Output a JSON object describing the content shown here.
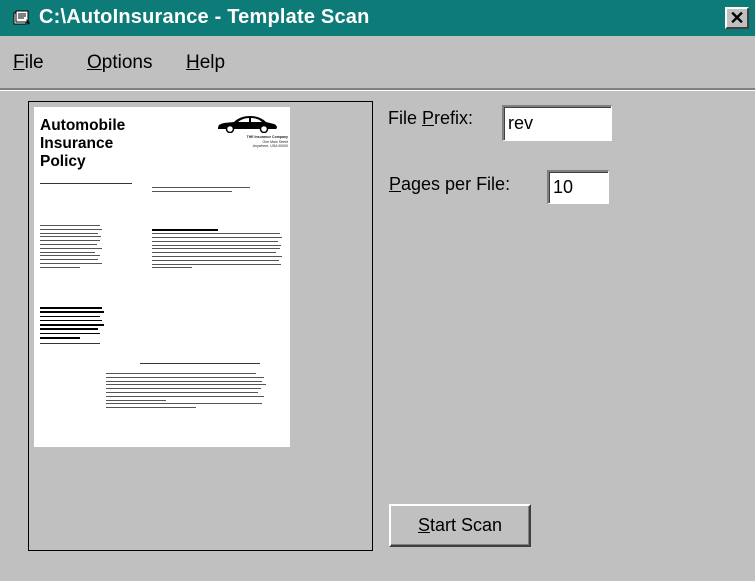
{
  "window": {
    "title": "C:\\AutoInsurance - Template Scan",
    "close_label": "✕"
  },
  "menu": [
    {
      "first": "F",
      "rest": "ile"
    },
    {
      "first": "O",
      "rest": "ptions"
    },
    {
      "first": "H",
      "rest": "elp"
    }
  ],
  "preview": {
    "title": [
      "Automobile",
      "Insurance",
      "Policy"
    ],
    "company": [
      "THE Insurance Company",
      "One Main Street",
      "Anywhere, USA 00000"
    ],
    "intro": "The company issuing this policy is shown on the Coverage Selections page.",
    "mutual_heading": "Mutual Policy Conditions"
  },
  "file_prefix": {
    "label_pre": "File ",
    "label_u": "P",
    "label_post": "refix:",
    "value": "rev"
  },
  "pages_per_file": {
    "label_pre": "",
    "label_u": "P",
    "label_post": "ages per File:",
    "value": "10"
  },
  "start_button": {
    "u": "S",
    "rest": "tart Scan"
  }
}
